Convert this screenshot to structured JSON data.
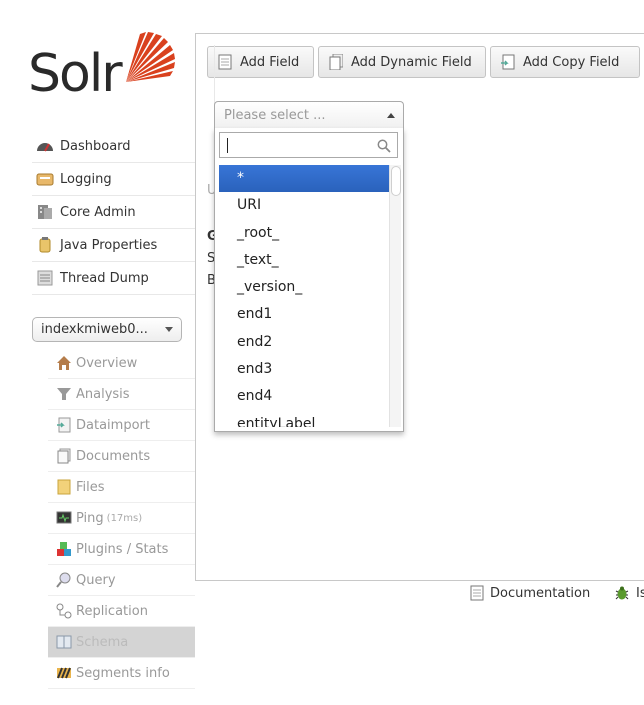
{
  "logo": {
    "text": "Solr"
  },
  "main_nav": [
    {
      "label": "Dashboard",
      "icon": "dashboard-icon"
    },
    {
      "label": "Logging",
      "icon": "logging-icon"
    },
    {
      "label": "Core Admin",
      "icon": "core-admin-icon"
    },
    {
      "label": "Java Properties",
      "icon": "java-properties-icon"
    },
    {
      "label": "Thread Dump",
      "icon": "thread-dump-icon"
    }
  ],
  "core_selector": {
    "value": "indexkmiweb0..."
  },
  "core_nav": [
    {
      "label": "Overview",
      "icon": "overview-icon"
    },
    {
      "label": "Analysis",
      "icon": "analysis-icon"
    },
    {
      "label": "Dataimport",
      "icon": "dataimport-icon"
    },
    {
      "label": "Documents",
      "icon": "documents-icon"
    },
    {
      "label": "Files",
      "icon": "files-icon"
    },
    {
      "label": "Ping",
      "sub": "(17ms)",
      "icon": "ping-icon"
    },
    {
      "label": "Plugins / Stats",
      "icon": "plugins-icon"
    },
    {
      "label": "Query",
      "icon": "query-icon"
    },
    {
      "label": "Replication",
      "icon": "replication-icon"
    },
    {
      "label": "Schema",
      "icon": "schema-icon",
      "active": true
    },
    {
      "label": "Segments info",
      "icon": "segments-icon"
    }
  ],
  "toolbar": {
    "add_field": "Add Field",
    "add_dynamic_field": "Add Dynamic Field",
    "add_copy_field": "Add Copy Field"
  },
  "background_text": {
    "u": "U",
    "g": "G",
    "s": "S",
    "b": "B"
  },
  "field_select": {
    "placeholder": "Please select ...",
    "search_value": "",
    "options": [
      "*",
      "URI",
      "_root_",
      "_text_",
      "_version_",
      "end1",
      "end2",
      "end3",
      "end4",
      "entityLabel"
    ],
    "highlighted_index": 0
  },
  "footer": {
    "documentation": "Documentation",
    "issue_tracker": "Is"
  },
  "colors": {
    "highlight": "#3875d7",
    "logo_red": "#d9411e"
  }
}
